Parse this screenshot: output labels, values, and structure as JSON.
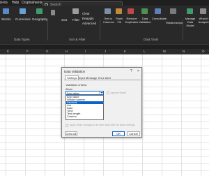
{
  "menu": {
    "items": [
      "d-ins",
      "Help",
      "Cryptosheets"
    ]
  },
  "search": {
    "placeholder": "Search"
  },
  "ribbon": {
    "data_types": [
      "Stocks",
      "Currencies",
      "Geography"
    ],
    "data_types_group": "Data Types",
    "sort_filter": [
      "Sort",
      "Filter"
    ],
    "sort_filter_extra": [
      "Clear",
      "Reapply",
      "Advanced"
    ],
    "sort_filter_group": "Sort & Filter",
    "data_tools": [
      "Text to Columns",
      "Flash Fill",
      "Remove Duplicates",
      "Data Validation",
      "Consolidate",
      "Relationships"
    ],
    "data_tools_group": "Data Tools",
    "manage_data_model": "Manage Data Model",
    "what_if": "What-If Analysis"
  },
  "columns": [
    "E",
    "F",
    "G",
    "H",
    "I",
    "J",
    "K",
    "L",
    "M",
    "N",
    "O"
  ],
  "dialog": {
    "title": "Data Validation",
    "help": "?",
    "close": "×",
    "tabs": [
      "Settings",
      "Input Message",
      "Error Alert"
    ],
    "criteria_label": "Validation criteria",
    "allow_label": "Allow:",
    "allow_value": "Any value",
    "ignore_blank": "Ignore blank",
    "list_options": [
      "Any value",
      "Whole number",
      "Decimal",
      "List",
      "Date",
      "Time",
      "Text length",
      "Custom"
    ],
    "selected_option": "Decimal",
    "apply_all": "Apply these changes to all other cells with the same settings",
    "clear_all": "Clear All",
    "ok": "OK",
    "cancel": "Cancel"
  },
  "colors": {
    "accent": "#0a64c8",
    "ribbon_bg": "#292929",
    "dialog_bg": "#f0f0f0"
  }
}
